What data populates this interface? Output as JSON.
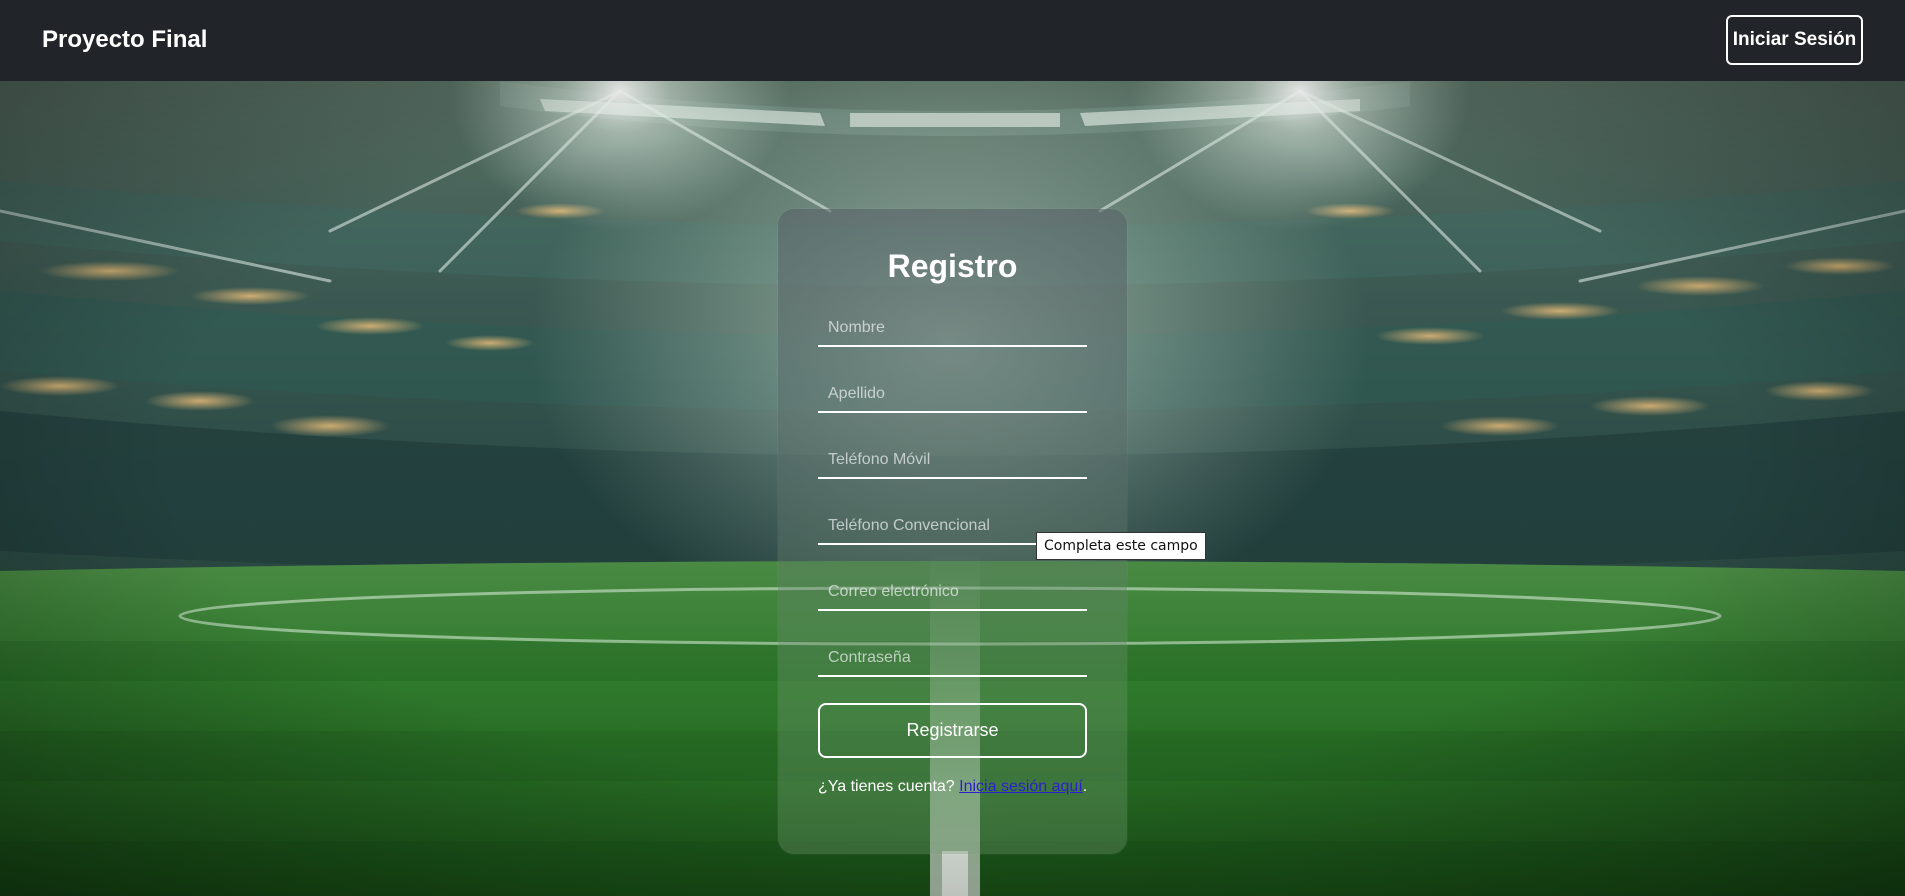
{
  "navbar": {
    "brand": "Proyecto Final",
    "login_button": "Iniciar Sesión"
  },
  "form": {
    "title": "Registro",
    "fields": [
      {
        "name": "first-name-input",
        "placeholder": "Nombre",
        "value": ""
      },
      {
        "name": "last-name-input",
        "placeholder": "Apellido",
        "value": ""
      },
      {
        "name": "mobile-phone-input",
        "placeholder": "Teléfono Móvil",
        "value": ""
      },
      {
        "name": "landline-phone-input",
        "placeholder": "Teléfono Convencional",
        "value": ""
      },
      {
        "name": "email-input",
        "placeholder": "Correo electrónico",
        "value": ""
      },
      {
        "name": "password-input",
        "placeholder": "Contraseña",
        "value": ""
      }
    ],
    "submit_label": "Registrarse",
    "footer_prefix": "¿Ya tienes cuenta?",
    "footer_link": "Inicia sesión aquí",
    "footer_suffix": "."
  },
  "tooltip": {
    "text": "Completa este campo"
  },
  "colors": {
    "navbar_bg": "#212529",
    "text": "#ffffff",
    "link": "#2a1fd1"
  }
}
